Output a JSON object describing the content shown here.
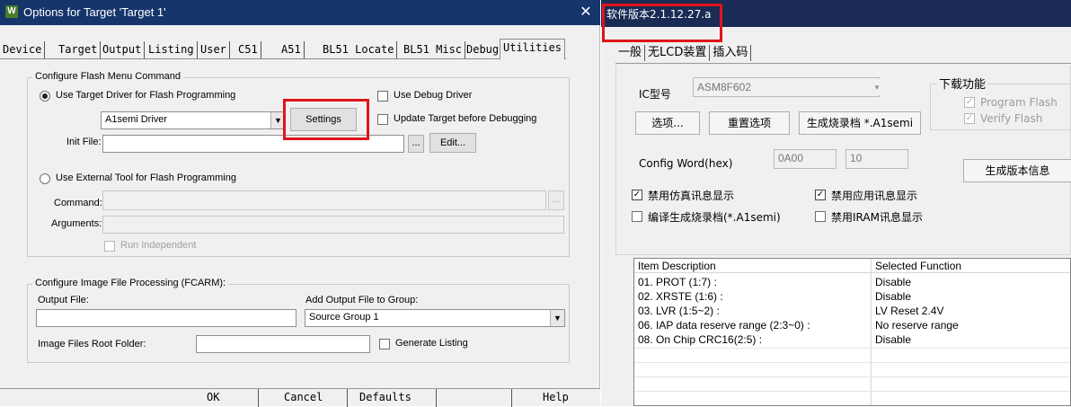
{
  "dialog": {
    "title": "Options for Target 'Target 1'",
    "icon_letter": "W",
    "tabs": [
      "Device",
      "Target",
      "Output",
      "Listing",
      "User",
      "C51",
      "A51",
      "BL51 Locate",
      "BL51 Misc",
      "Debug",
      "Utilities"
    ],
    "active_tab": "Utilities",
    "flash": {
      "group_label": "Configure Flash Menu Command",
      "use_target_driver": "Use Target Driver for Flash Programming",
      "use_debug_driver": "Use Debug Driver",
      "driver_value": "A1semi Driver",
      "settings": "Settings",
      "update_target": "Update Target before Debugging",
      "init_file_label": "Init File:",
      "init_file_value": "",
      "browse": "...",
      "edit": "Edit...",
      "use_external_tool": "Use External Tool for Flash Programming",
      "command_label": "Command:",
      "arguments_label": "Arguments:",
      "run_independent": "Run Independent"
    },
    "image": {
      "group_label": "Configure Image File Processing (FCARM):",
      "output_file_label": "Output File:",
      "add_output_label": "Add Output File  to Group:",
      "group_value": "Source Group 1",
      "root_folder_label": "Image Files Root Folder:",
      "generate_listing": "Generate Listing"
    },
    "buttons": {
      "ok": "OK",
      "cancel": "Cancel",
      "defaults": "Defaults",
      "help": "Help"
    }
  },
  "panel": {
    "version": "软件版本2.1.12.27.a",
    "tabs": [
      "一般",
      "无LCD装置",
      "插入码"
    ],
    "ic_label": "IC型号",
    "ic_value": "ASM8F602",
    "download_label": "下载功能",
    "program_flash": "Program Flash",
    "verify_flash": "Verify Flash",
    "btn_options": "选项...",
    "btn_reset": "重置选项",
    "btn_generate": "生成烧录档 *.A1semi",
    "config_word_label": "Config Word(hex)",
    "config_word_1": "0A00",
    "config_word_2": "10",
    "btn_version_info": "生成版本信息",
    "chk_emu_msg": "禁用仿真讯息显示",
    "chk_app_msg": "禁用应用讯息显示",
    "chk_compile_gen": "编译生成烧录档(*.A1semi)",
    "chk_iram_msg": "禁用IRAM讯息显示",
    "table": {
      "headers": [
        "Item Description",
        "Selected Function"
      ],
      "rows": [
        [
          "01. PROT (1:7) :",
          "Disable"
        ],
        [
          "02. XRSTE (1:6) :",
          "Disable"
        ],
        [
          "03. LVR (1:5~2) :",
          "LV Reset 2.4V"
        ],
        [
          "06. IAP data reserve range (2:3~0) :",
          "No reserve range"
        ],
        [
          "08. On Chip CRC16(2:5) :",
          "Disable"
        ]
      ]
    }
  },
  "colors": {
    "highlight": "#e0141a",
    "dialog_title": "#15356b",
    "panel_title": "#1a2b55"
  }
}
